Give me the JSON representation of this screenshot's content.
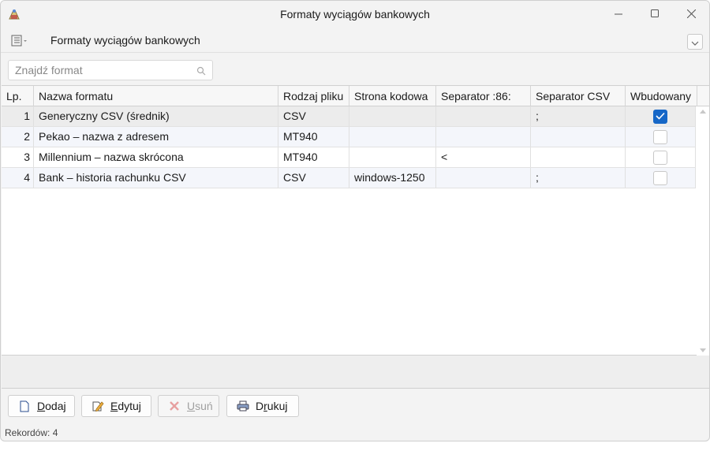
{
  "window": {
    "title": "Formaty wyciągów bankowych",
    "subtitle": "Formaty wyciągów bankowych"
  },
  "search": {
    "placeholder": "Znajdź format",
    "value": ""
  },
  "table": {
    "columns": [
      "Lp.",
      "Nazwa formatu",
      "Rodzaj pliku",
      "Strona kodowa",
      "Separator :86:",
      "Separator CSV",
      "Wbudowany"
    ],
    "rows": [
      {
        "lp": "1",
        "name": "Generyczny CSV (średnik)",
        "type": "CSV",
        "codepage": "",
        "sep86": "",
        "sepcsv": ";",
        "builtin": true
      },
      {
        "lp": "2",
        "name": "Pekao – nazwa z adresem",
        "type": "MT940",
        "codepage": "",
        "sep86": "",
        "sepcsv": "",
        "builtin": false
      },
      {
        "lp": "3",
        "name": "Millennium – nazwa skrócona",
        "type": "MT940",
        "codepage": "",
        "sep86": "<",
        "sepcsv": "",
        "builtin": false
      },
      {
        "lp": "4",
        "name": "Bank – historia rachunku CSV",
        "type": "CSV",
        "codepage": "windows-1250",
        "sep86": "",
        "sepcsv": ";",
        "builtin": false
      }
    ]
  },
  "buttons": {
    "add": {
      "prefix": "",
      "hotkey": "D",
      "rest": "odaj"
    },
    "edit": {
      "prefix": "",
      "hotkey": "E",
      "rest": "dytuj"
    },
    "delete": {
      "prefix": "",
      "hotkey": "U",
      "rest": "suń"
    },
    "print": {
      "prefix": "D",
      "hotkey": "r",
      "rest": "ukuj"
    }
  },
  "status": {
    "records": "Rekordów: 4"
  },
  "colors": {
    "accent": "#1667c7",
    "row_alt": "#f4f6fb",
    "row_selected": "#ececec"
  },
  "icons": [
    "app-icon",
    "list-menu-icon",
    "chevron-down-icon",
    "search-icon",
    "minimize-icon",
    "maximize-icon",
    "close-icon",
    "document-icon",
    "edit-icon",
    "delete-icon",
    "print-icon",
    "checkmark-icon"
  ]
}
